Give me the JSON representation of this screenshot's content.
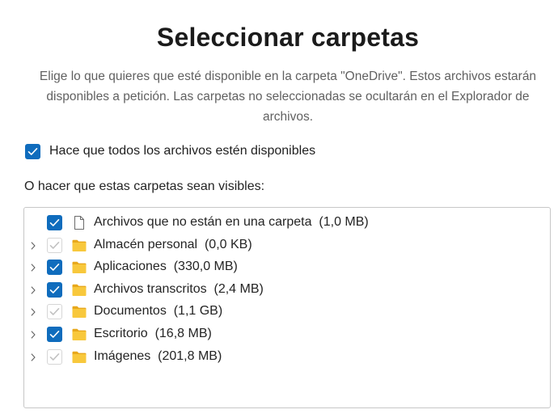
{
  "dialog": {
    "title": "Seleccionar carpetas",
    "description": "Elige lo que quieres que esté disponible en la carpeta \"OneDrive\". Estos archivos estarán disponibles a petición. Las carpetas no seleccionadas se ocultarán en el Explorador de archivos.",
    "make_all_available": {
      "label": "Hace que todos los archivos estén disponibles",
      "checked": true
    },
    "folders_subtitle": "O hacer que estas carpetas sean visibles:"
  },
  "tree": {
    "items": [
      {
        "name": "Archivos que no están en una carpeta",
        "size": "(1,0 MB)",
        "checked": true,
        "enabled": true,
        "expandable": false,
        "icon": "file-icon"
      },
      {
        "name": "Almacén personal",
        "size": "(0,0 KB)",
        "checked": true,
        "enabled": false,
        "expandable": true,
        "icon": "folder-icon"
      },
      {
        "name": "Aplicaciones",
        "size": "(330,0 MB)",
        "checked": true,
        "enabled": true,
        "expandable": true,
        "icon": "folder-icon"
      },
      {
        "name": "Archivos transcritos",
        "size": "(2,4 MB)",
        "checked": true,
        "enabled": true,
        "expandable": true,
        "icon": "folder-icon"
      },
      {
        "name": "Documentos",
        "size": "(1,1 GB)",
        "checked": true,
        "enabled": false,
        "expandable": true,
        "icon": "folder-icon"
      },
      {
        "name": "Escritorio",
        "size": "(16,8 MB)",
        "checked": true,
        "enabled": true,
        "expandable": true,
        "icon": "folder-icon"
      },
      {
        "name": "Imágenes",
        "size": "(201,8 MB)",
        "checked": true,
        "enabled": false,
        "expandable": true,
        "icon": "folder-icon"
      }
    ]
  },
  "colors": {
    "accent": "#0f6cbd",
    "folder": "#f8c83c",
    "text": "#242424",
    "muted": "#616161"
  }
}
